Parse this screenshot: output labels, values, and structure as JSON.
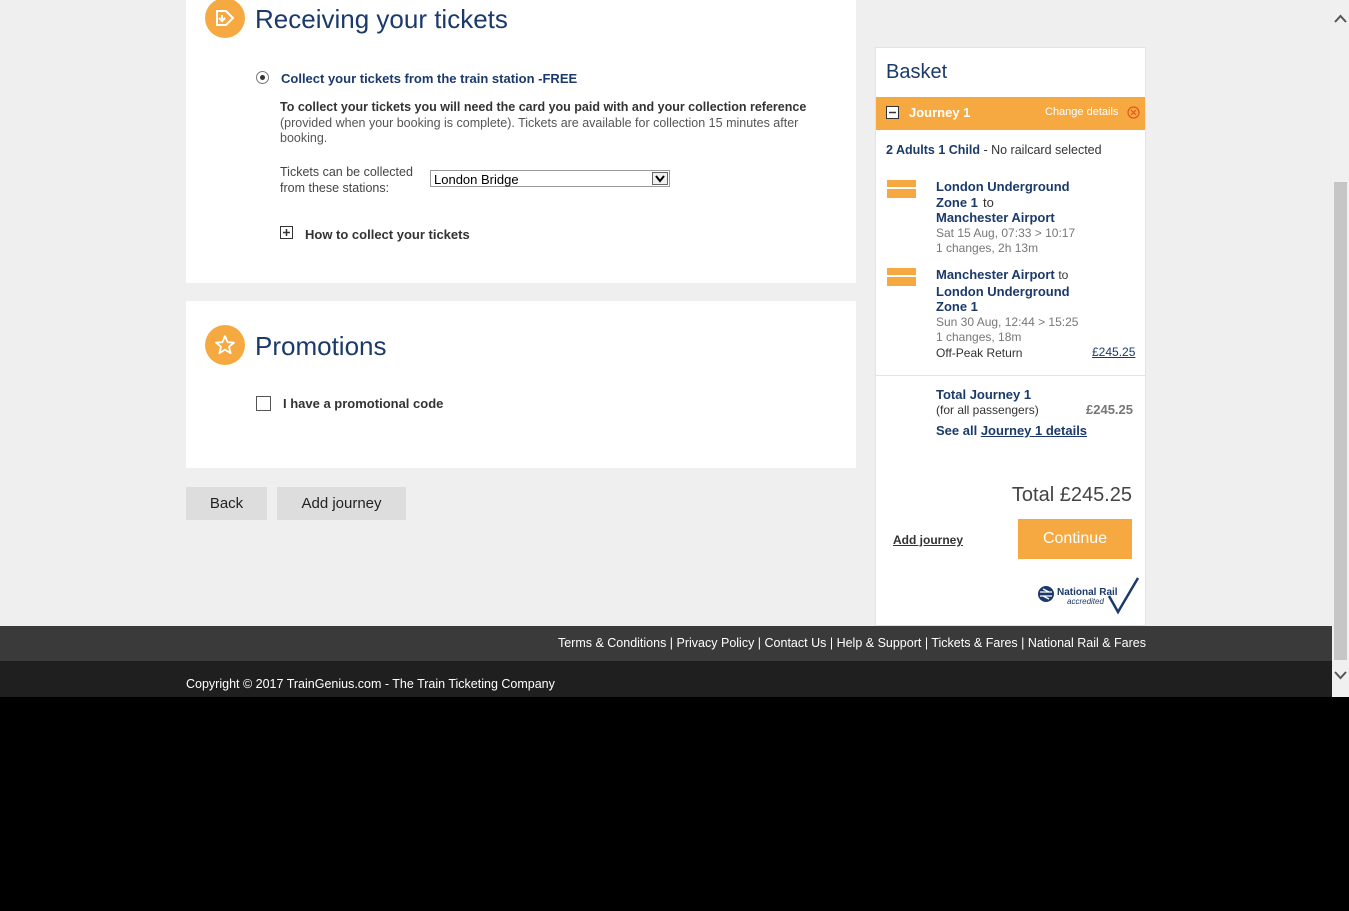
{
  "receiving": {
    "title": "Receiving your tickets",
    "option_label": "Collect your tickets from the train station -FREE",
    "info_bold": "To collect your tickets you will need the card you paid with and your collection reference",
    "info_rest": " (provided when your booking is complete). Tickets are available for collection 15 minutes after booking.",
    "stations_label_line1": "Tickets can be collected",
    "stations_label_line2": "from these stations:",
    "station_selected": "London Bridge",
    "how_to_collect": "How to collect your tickets"
  },
  "promotions": {
    "title": "Promotions",
    "promo_label": "I have a promotional code"
  },
  "buttons": {
    "back": "Back",
    "add_journey": "Add journey"
  },
  "basket": {
    "title": "Basket",
    "journey_label": "Journey 1",
    "change_details": "Change details",
    "passengers_bold": "2 Adults 1 Child",
    "passengers_rest": " - No railcard selected",
    "legs": [
      {
        "from": "London Underground Zone 1",
        "to_word": "to",
        "to": "Manchester Airport",
        "datetime": "Sat 15 Aug, 07:33 > 10:17",
        "changes": "1 changes, 2h 13m"
      },
      {
        "from": "Manchester Airport",
        "to_word": "to",
        "to": "London Underground Zone 1",
        "datetime": "Sun 30 Aug, 12:44 > 15:25",
        "changes": "1 changes, 18m"
      }
    ],
    "fare_type": "Off-Peak Return",
    "fare_price": "£245.25",
    "total_journey_label": "Total Journey 1",
    "for_all": "(for all passengers)",
    "total_journey_price": "£245.25",
    "see_all": "See all",
    "journey_details_link": "Journey 1 details",
    "total": "Total £245.25",
    "add_journey_link": "Add journey",
    "continue": "Continue",
    "accredited_line1": "National Rail",
    "accredited_line2": "accredited"
  },
  "footer": {
    "links": [
      "Terms & Conditions",
      "Privacy Policy",
      "Contact Us",
      "Help & Support",
      "Tickets & Fares",
      "National Rail & Fares"
    ],
    "copyright": "Copyright © 2017 TrainGenius.com - The Train Ticketing Company"
  },
  "colors": {
    "accent": "#f7a941",
    "navy": "#1b3a6b",
    "page_bg": "#efefef"
  },
  "icons": [
    "ticket-arrow-icon",
    "star-icon",
    "plus-icon",
    "minus-icon",
    "close-circle-icon",
    "ticket-icon",
    "national-rail-logo",
    "chevron-up-icon",
    "chevron-down-icon"
  ]
}
